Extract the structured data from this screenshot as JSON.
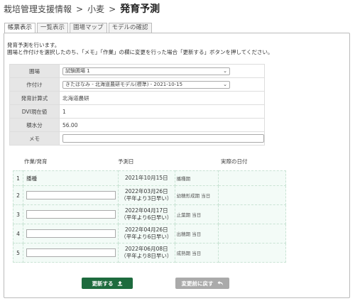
{
  "breadcrumb": {
    "root": "栽培管理支援情報",
    "sep1": ">",
    "middle": "小麦",
    "sep2": ">",
    "current": "発育予測"
  },
  "tabs": [
    {
      "label": "帳票表示",
      "active": true
    },
    {
      "label": "一覧表示",
      "active": false
    },
    {
      "label": "圃場マップ",
      "active": false
    },
    {
      "label": "モデルの確認",
      "active": false
    }
  ],
  "intro": {
    "line1": "発育予測を行います。",
    "line2": "圃場と作付けを選択したのち、「メモ」「作業」の欄に変更を行った場合「更新する」ボタンを押してください。"
  },
  "form": {
    "field_label": "圃場",
    "field_value": "試験圃場 1",
    "crop_label": "作付け",
    "crop_value": "きたほなみ - 北海道農研モデル(標準) - 2021-10-15",
    "method_label": "発育計算式",
    "method_value": "北海道農研",
    "dvi_label": "DVI現在値",
    "dvi_value": "1",
    "water_label": "積水分",
    "water_value": "56.00",
    "memo_label": "メモ",
    "memo_value": ""
  },
  "schedule": {
    "headers": {
      "work": "作業/発育",
      "predicted": "予測日",
      "actual": "実際の日付"
    },
    "rows": [
      {
        "num": "1",
        "work": "播種",
        "date": "2021年10月15日",
        "note": "",
        "stage": "播種期"
      },
      {
        "num": "2",
        "work": "",
        "date": "2022年03月26日",
        "note": "（平年より3日早い）",
        "stage": "幼穂形成期 当日"
      },
      {
        "num": "3",
        "work": "",
        "date": "2022年04月17日",
        "note": "（平年より6日早い）",
        "stage": "止葉期 当日"
      },
      {
        "num": "4",
        "work": "",
        "date": "2022年04月26日",
        "note": "（平年より6日早い）",
        "stage": "出穂期 当日"
      },
      {
        "num": "5",
        "work": "",
        "date": "2022年06月08日",
        "note": "（平年より8日早い）",
        "stage": "成熟期 当日"
      }
    ]
  },
  "buttons": {
    "update": "更新する",
    "revert": "変更前に戻す"
  },
  "colors": {
    "primary": "#1e6b3e",
    "disabled": "#aaaaaa",
    "row_bg": "#f3fbf7"
  }
}
